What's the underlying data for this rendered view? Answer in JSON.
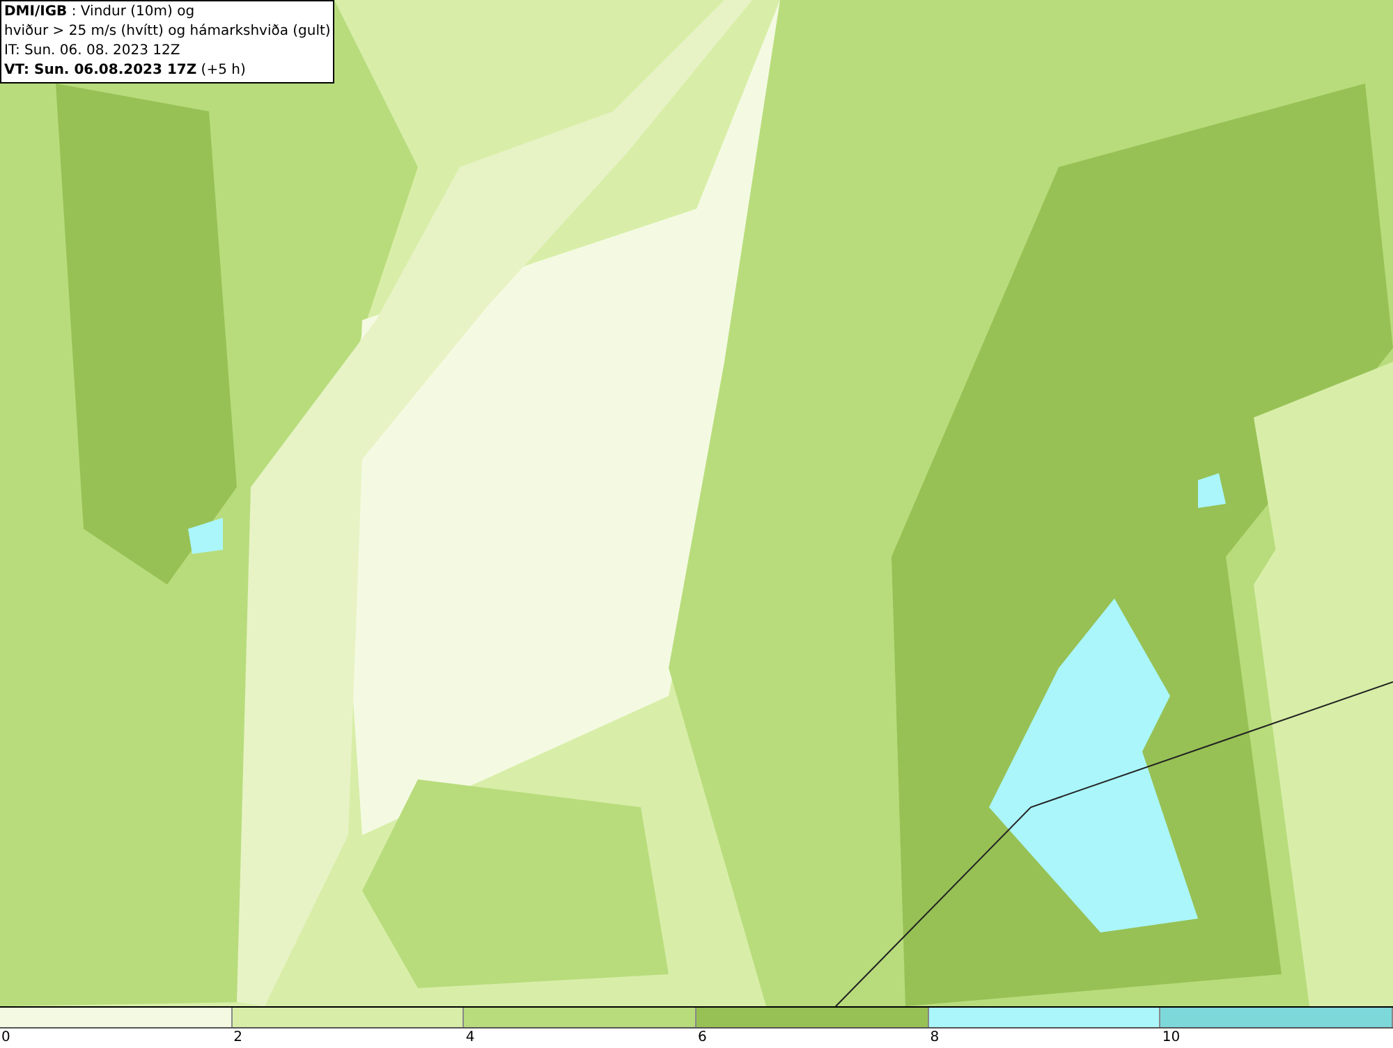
{
  "info_box": {
    "lines": [
      "**DMI/IGB** : Vindur (10m) og",
      "hviður > 25 m/s (hvítt) og hámarkshviða (gult)",
      "IT: Sun. 06. 08. 2023 12Z",
      "**VT: Sun. 06.08.2023 17Z** (+5 h)"
    ]
  },
  "legend": {
    "segments": [
      {
        "color": "#f4fae2"
      },
      {
        "color": "#d8eea8"
      },
      {
        "color": "#b8dc7c"
      },
      {
        "color": "#97c155"
      },
      {
        "color": "#aaf6fb"
      },
      {
        "color": "#7dd8da"
      }
    ],
    "ticks": [
      "0",
      "2",
      "4",
      "6",
      "8",
      "10"
    ]
  }
}
